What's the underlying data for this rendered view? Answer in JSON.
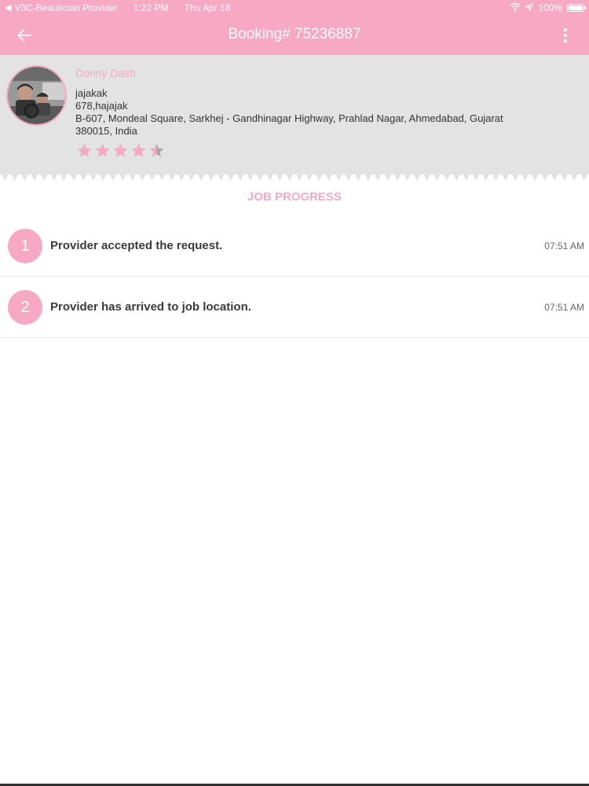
{
  "status_bar": {
    "carrier": "V3C-Beautician Provider",
    "time": "1:22 PM",
    "date": "Thu Apr 18",
    "battery": "100%",
    "battery_level": 1.0,
    "icons": [
      "back-caret-icon",
      "wifi-icon",
      "location-arrow-icon",
      "battery-icon"
    ]
  },
  "app_bar": {
    "title": "Booking# 75236887",
    "back_icon": "arrow-left-icon",
    "menu_icon": "more-vertical-icon"
  },
  "customer": {
    "name": "Donny Dash",
    "address_lines": [
      "jajakak",
      "678,hajajak",
      "B-607,  Mondeal Square,  Sarkhej - Gandhinagar Highway,  Prahlad Nagar,  Ahmedabad,  Gujarat",
      "380015,  India"
    ],
    "rating": 4.5,
    "rating_max": 5
  },
  "job_progress": {
    "title": "JOB PROGRESS",
    "steps": [
      {
        "number": "1",
        "text": "Provider accepted the request.",
        "time": "07:51 AM"
      },
      {
        "number": "2",
        "text": "Provider has arrived to job location.",
        "time": "07:51 AM"
      }
    ]
  },
  "colors": {
    "brand_pink": "#f7a8c2",
    "header_gray": "#e3e3e3",
    "star_empty": "#a6a6a6"
  }
}
